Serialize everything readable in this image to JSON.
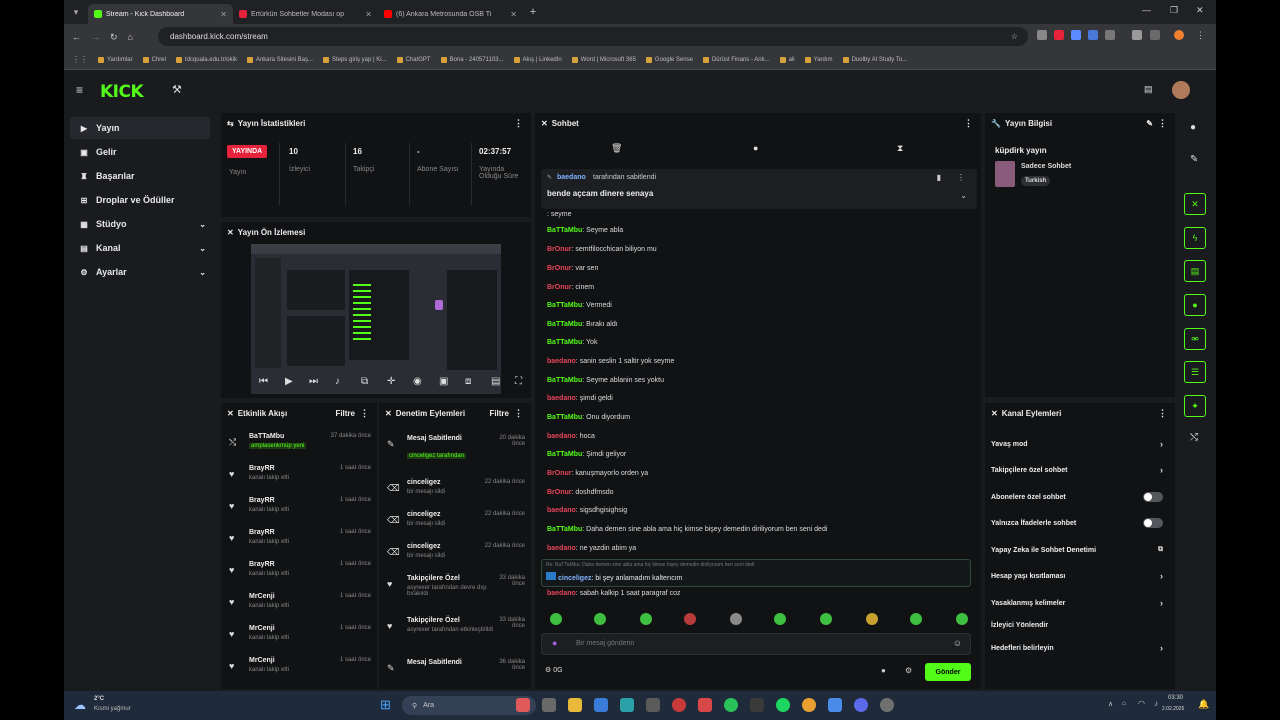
{
  "browser": {
    "tabs": [
      {
        "title": "Stream - Kick Dashboard",
        "active": true,
        "color": "#53fc18"
      },
      {
        "title": "Ertürkün Sohbetler Modası op",
        "active": false,
        "color": "#e5233b"
      },
      {
        "title": "(6) Ankara Metrosunda OSB Ti",
        "active": false,
        "color": "#ff0000"
      }
    ],
    "new_tab": "+",
    "url": "dashboard.kick.com/stream",
    "bookmarks": [
      "Yardımlar",
      "Chrel",
      "tdcquala.edu.tr/okik",
      "Ankara Sitesini Baş...",
      "Steps giriş yap | Ki...",
      "ChatGPT",
      "Bona - 240571103...",
      "Akış | LinkedIn",
      "Word | Microsoft 365",
      "Google Sense",
      "Dürüst Finans - Ank...",
      "ali",
      "Yardım",
      "Duolby AI Study To..."
    ]
  },
  "kick": {
    "logo": "KICK",
    "nav": [
      {
        "label": "Yayın",
        "icon": "play-icon",
        "active": true
      },
      {
        "label": "Gelir",
        "icon": "money-icon"
      },
      {
        "label": "Başarılar",
        "icon": "trophy-icon"
      },
      {
        "label": "Droplar ve Ödüller",
        "icon": "gift-icon"
      },
      {
        "label": "Stüdyo",
        "icon": "studio-icon",
        "chevron": true
      },
      {
        "label": "Kanal",
        "icon": "channel-icon",
        "chevron": true
      },
      {
        "label": "Ayarlar",
        "icon": "gear-icon",
        "chevron": true
      }
    ]
  },
  "stats": {
    "title": "Yayın İstatistikleri",
    "live_badge": "YAYINDA",
    "items": [
      {
        "label": "Yayın",
        "value": ""
      },
      {
        "label": "İzleyici",
        "value": "10"
      },
      {
        "label": "Takipçi",
        "value": "16"
      },
      {
        "label": "Abone Sayısı",
        "value": "-"
      },
      {
        "label": "Yayında Olduğu Süre",
        "value": "02:37:57"
      }
    ]
  },
  "preview": {
    "title": "Yayın Ön İzlemesi"
  },
  "activity": {
    "title": "Etkinlik Akışı",
    "filter": "Filtre",
    "items": [
      {
        "name": "BaTTaMbu",
        "sub": "amplasenkmüp yeni",
        "time": "37 dakika önce",
        "icon": "share-icon"
      },
      {
        "name": "BrayRR",
        "sub": "kanalı takip etti",
        "time": "1 saat önce",
        "icon": "heart-icon"
      },
      {
        "name": "BrayRR",
        "sub": "kanalı takip etti",
        "time": "1 saat önce",
        "icon": "heart-icon"
      },
      {
        "name": "BrayRR",
        "sub": "kanalı takip etti",
        "time": "1 saat önce",
        "icon": "heart-icon"
      },
      {
        "name": "BrayRR",
        "sub": "kanalı takip etti",
        "time": "1 saat önce",
        "icon": "heart-icon"
      },
      {
        "name": "MrCenji",
        "sub": "kanalı takip etti",
        "time": "1 saat önce",
        "icon": "heart-icon"
      },
      {
        "name": "MrCenji",
        "sub": "kanalı takip etti",
        "time": "1 saat önce",
        "icon": "heart-icon"
      },
      {
        "name": "MrCenji",
        "sub": "kanalı takip etti",
        "time": "1 saat önce",
        "icon": "heart-icon"
      }
    ]
  },
  "moderation": {
    "title": "Denetim Eylemleri",
    "filter": "Filtre",
    "items": [
      {
        "name": "Mesaj Sabitlendi",
        "sub": "cinceligez tarafından",
        "time": "20 dakika önce",
        "icon": "pin-icon"
      },
      {
        "name": "cinceligez",
        "sub": "bir mesajı sildi",
        "time": "22 dakika önce",
        "icon": "trash-icon"
      },
      {
        "name": "cinceligez",
        "sub": "bir mesajı sildi",
        "time": "22 dakika önce",
        "icon": "trash-icon"
      },
      {
        "name": "cinceligez",
        "sub": "bir mesajı sildi",
        "time": "22 dakika önce",
        "icon": "trash-icon"
      },
      {
        "name": "Takipçilere Özel",
        "sub": "asyrexer tarafından devre dışı bırakıldı",
        "time": "33 dakika önce",
        "icon": "heart-icon"
      },
      {
        "name": "Takipçilere Özel",
        "sub": "asyrexer tarafından etkinleştirildi",
        "time": "33 dakika önce",
        "icon": "heart-icon"
      },
      {
        "name": "Mesaj Sabitlendi",
        "sub": "",
        "time": "36 dakika önce",
        "icon": "pin-icon"
      }
    ]
  },
  "chat": {
    "title": "Sohbet",
    "pinned_by": "tarafından sabitlendi",
    "pinned_user": "baedano",
    "pinned_text": "bende açcam dinere senaya",
    "messages": [
      {
        "user": "",
        "text": "seyme",
        "color": "red"
      },
      {
        "user": "BaTTaMbu",
        "text": "Seyme abla",
        "color": "green"
      },
      {
        "user": "BrOnur",
        "text": "semtfilocchican biliyon mu",
        "color": "red"
      },
      {
        "user": "BrOnur",
        "text": "var sen",
        "color": "red"
      },
      {
        "user": "BrOnur",
        "text": "cinem",
        "color": "red"
      },
      {
        "user": "BaTTaMbu",
        "text": "Vermedi",
        "color": "green"
      },
      {
        "user": "BaTTaMbu",
        "text": "Bırakı aldı",
        "color": "green"
      },
      {
        "user": "BaTTaMbu",
        "text": "Yok",
        "color": "green"
      },
      {
        "user": "baedano",
        "text": "sanin seslin 1 saltir yok seyme",
        "color": "red"
      },
      {
        "user": "BaTTaMbu",
        "text": "Seyme ablanin ses yoktu",
        "color": "green"
      },
      {
        "user": "baedano",
        "text": "şimdi geldi",
        "color": "red"
      },
      {
        "user": "BaTTaMbu",
        "text": "Onu diyordum",
        "color": "green"
      },
      {
        "user": "baedano",
        "text": "hoca",
        "color": "red"
      },
      {
        "user": "BaTTaMbu",
        "text": "Şimdi geliyor",
        "color": "green"
      },
      {
        "user": "BrOnur",
        "text": "kanuşmayorlo orden ya",
        "color": "red"
      },
      {
        "user": "BrOnur",
        "text": "doshdfmsdo",
        "color": "red"
      },
      {
        "user": "baedano",
        "text": "sigsdhgisighsig",
        "color": "red"
      },
      {
        "user": "BaTTaMbu",
        "text": "Daha demen sine abla ama hiç kimse bişey demedin diriliyorum ben seni dedi",
        "color": "green"
      },
      {
        "user": "baedano",
        "text": "ne yazdin abim ya",
        "color": "red"
      }
    ],
    "reply_context": "Re: BaTTaMbu: Daha demen sine abla ama hiç kimse bişey demedin diriliyorum ben seni dedi",
    "reply_user": "cinceligez",
    "reply_text": "bi şey anlamadım kalterıcım",
    "last_user": "baedano",
    "last_text": "sabah kalkip 1 saat paragraf coz",
    "input_placeholder": "Bir mesaj gönderin",
    "points": "0G",
    "send": "Gönder"
  },
  "stream_info": {
    "title": "Yayın Bilgisi",
    "stream_title": "küpdirk yayın",
    "category": "Sadece Sohbet",
    "tag": "Turkish"
  },
  "channel_actions": {
    "title": "Kanal Eylemleri",
    "items": [
      {
        "label": "Yavaş mod",
        "type": "arrow"
      },
      {
        "label": "Takipçilere özel sohbet",
        "type": "arrow"
      },
      {
        "label": "Abonelere özel sohbet",
        "type": "toggle"
      },
      {
        "label": "Yalnızca İfadelerle sohbet",
        "type": "toggle"
      },
      {
        "label": "Yapay Zeka ile Sohbet Denetimi",
        "type": "external"
      },
      {
        "label": "Hesap yaşı kısıtlaması",
        "type": "arrow"
      },
      {
        "label": "Yasaklanmış kelimeler",
        "type": "arrow"
      },
      {
        "label": "İzleyici Yönlendir",
        "type": "none"
      },
      {
        "label": "Hedefleri belirleyin",
        "type": "arrow"
      }
    ]
  },
  "taskbar": {
    "weather_temp": "2°C",
    "weather_text": "Kısmi yağmur",
    "search": "Ara",
    "time": "03:30",
    "date": "2.02.2025"
  },
  "colors": {
    "accent": "#53fc18",
    "live": "#e5233b",
    "panel": "#111214",
    "bg": "#191b1f"
  }
}
